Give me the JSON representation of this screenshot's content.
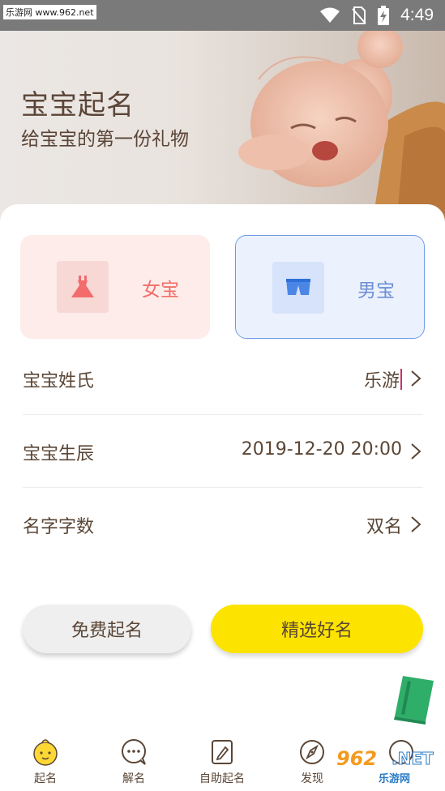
{
  "status_bar": {
    "time": "4:49",
    "watermark": "乐游网 www.962.net"
  },
  "banner": {
    "title": "宝宝起名",
    "subtitle": "给宝宝的第一份礼物"
  },
  "gender": {
    "girl_label": "女宝",
    "boy_label": "男宝",
    "girl_icon": "dress-icon",
    "boy_icon": "shorts-icon",
    "selected": "boy"
  },
  "form": {
    "surname_label": "宝宝姓氏",
    "surname_value": "乐游",
    "birth_label": "宝宝生辰",
    "birth_value": "2019-12-20 20:00",
    "count_label": "名字字数",
    "count_value": "双名"
  },
  "buttons": {
    "free": "免费起名",
    "premium": "精选好名"
  },
  "nav": [
    {
      "label": "起名",
      "icon": "baby-face-icon",
      "active": true
    },
    {
      "label": "解名",
      "icon": "chat-bubble-icon"
    },
    {
      "label": "自助起名",
      "icon": "edit-icon"
    },
    {
      "label": "发现",
      "icon": "compass-icon"
    }
  ],
  "watermark_bottom": {
    "num": "962",
    "net": ".NET",
    "cn": "乐游网"
  },
  "colors": {
    "accent": "#fde300",
    "girl": "#ef6f6a",
    "boy": "#6f8fd6",
    "text": "#5a4636"
  }
}
